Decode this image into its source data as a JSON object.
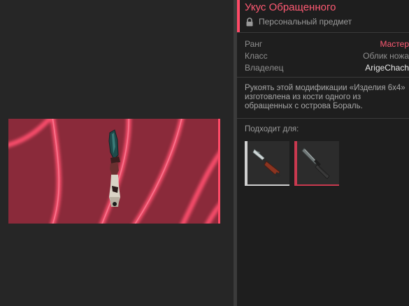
{
  "item": {
    "title": "Укус Обращенного",
    "subtitle": "Персональный предмет",
    "lock_icon": "lock-icon",
    "accent_color": "#ff4a67"
  },
  "properties": [
    {
      "label": "Ранг",
      "value": "Мастер",
      "color": "#ff5a73"
    },
    {
      "label": "Класс",
      "value": "Облик ножа",
      "color": "#8f8f8f"
    },
    {
      "label": "Владелец",
      "value": "ArigeChach",
      "color": "#e8e8e8"
    }
  ],
  "description": "Рукоять этой модификации «Изделия 6х4» изготовлена из кости одного из обращенных с острова Бораль.",
  "fits": {
    "label": "Подходит для:",
    "items": [
      {
        "icon": "bayonet-knife-icon",
        "rarity_color": "#cfcfcf"
      },
      {
        "icon": "combat-knife-icon",
        "rarity_color": "#c9394f"
      }
    ]
  },
  "preview": {
    "icon": "knife-preview-icon",
    "background_color": "#8a2a3a"
  }
}
